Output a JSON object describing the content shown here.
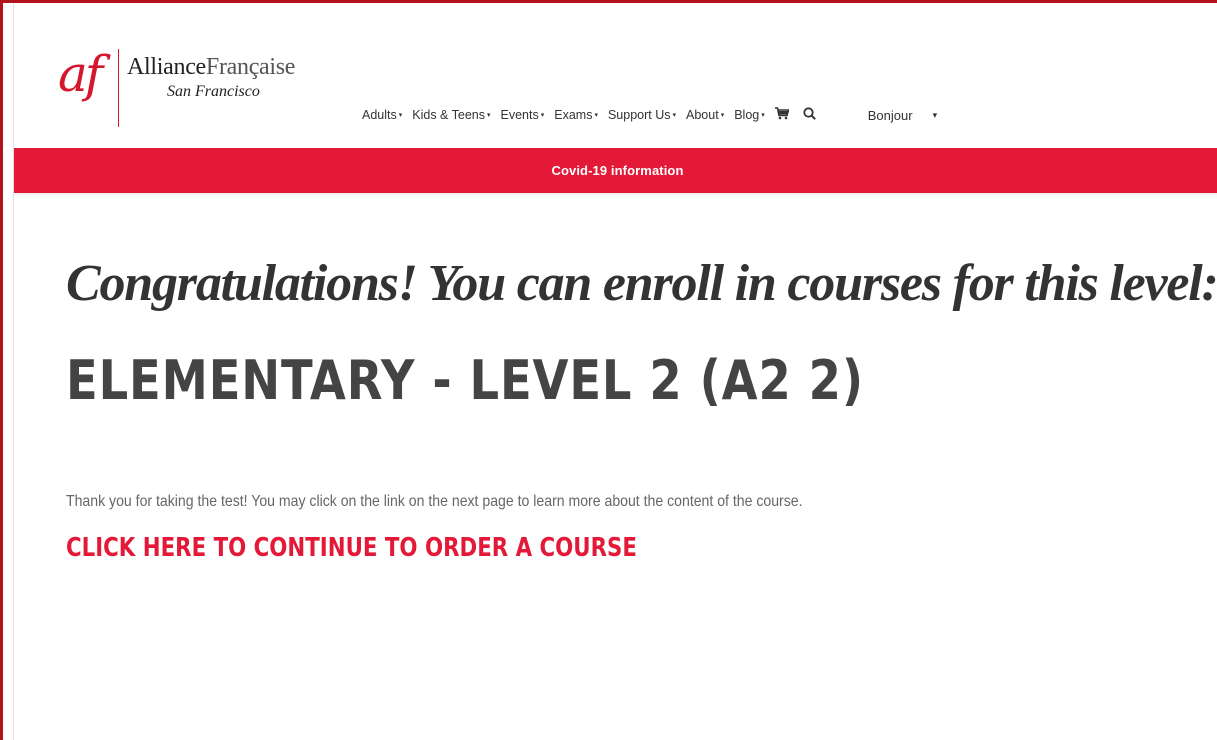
{
  "brand": {
    "mark": "af",
    "name_bold": "Alliance",
    "name_light": "Française",
    "city": "San Francisco",
    "accent": "#e31937"
  },
  "nav": {
    "items": [
      {
        "label": "Adults"
      },
      {
        "label": "Kids & Teens"
      },
      {
        "label": "Events"
      },
      {
        "label": "Exams"
      },
      {
        "label": "Support Us"
      },
      {
        "label": "About"
      },
      {
        "label": "Blog"
      }
    ],
    "caret": "▾",
    "cart_icon": "cart-icon",
    "search_icon": "search-icon",
    "language": "Bonjour",
    "language_chevron": "▾"
  },
  "banner": {
    "link": "Covid-19 information",
    "color": "#e31937"
  },
  "main": {
    "heading": "Congratulations! You can enroll in courses for this level:",
    "level": "ELEMENTARY - LEVEL 2 (A2 2)",
    "message": "Thank you for taking the test! You may click on the link on the next page to learn more about the content of the course.",
    "cta": "CLICK HERE TO CONTINUE TO ORDER A COURSE"
  }
}
